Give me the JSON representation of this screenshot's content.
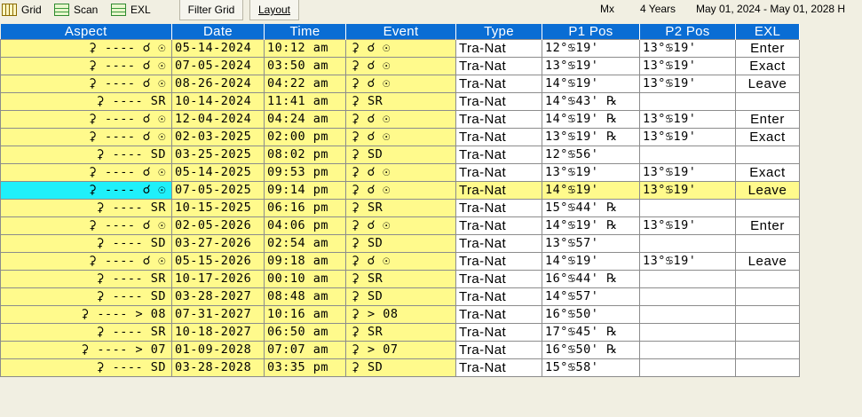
{
  "toolbar": {
    "grid_label": "Grid",
    "scan_label": "Scan",
    "exl_label": "EXL",
    "filter_grid_label": "Filter Grid",
    "layout_label": "Layout",
    "mx_label": "Mx",
    "span_label": "4 Years",
    "range_label": "May 01, 2024 - May 01, 2028 H"
  },
  "table": {
    "headers": {
      "aspect": "Aspect",
      "date": "Date",
      "time": "Time",
      "event": "Event",
      "type": "Type",
      "p1": "P1 Pos",
      "p2": "P2 Pos",
      "exl": "EXL"
    },
    "rows": [
      {
        "aspect": "⚳ ---- ☌ ☉",
        "date": "05-14-2024",
        "time": "10:12 am",
        "event": "⚳ ☌ ☉",
        "type": "Tra-Nat",
        "p1": "12°♋19'",
        "p2": "13°♋19'",
        "exl": "Enter",
        "highlight": false
      },
      {
        "aspect": "⚳ ---- ☌ ☉",
        "date": "07-05-2024",
        "time": "03:50 am",
        "event": "⚳ ☌ ☉",
        "type": "Tra-Nat",
        "p1": "13°♋19'",
        "p2": "13°♋19'",
        "exl": "Exact",
        "highlight": false
      },
      {
        "aspect": "⚳ ---- ☌ ☉",
        "date": "08-26-2024",
        "time": "04:22 am",
        "event": "⚳ ☌ ☉",
        "type": "Tra-Nat",
        "p1": "14°♋19'",
        "p2": "13°♋19'",
        "exl": "Leave",
        "highlight": false
      },
      {
        "aspect": "⚳ ---- SR",
        "date": "10-14-2024",
        "time": "11:41 am",
        "event": "⚳ SR",
        "type": "Tra-Nat",
        "p1": "14°♋43' ℞",
        "p2": "",
        "exl": "",
        "highlight": false
      },
      {
        "aspect": "⚳ ---- ☌ ☉",
        "date": "12-04-2024",
        "time": "04:24 am",
        "event": "⚳ ☌ ☉",
        "type": "Tra-Nat",
        "p1": "14°♋19' ℞",
        "p2": "13°♋19'",
        "exl": "Enter",
        "highlight": false
      },
      {
        "aspect": "⚳ ---- ☌ ☉",
        "date": "02-03-2025",
        "time": "02:00 pm",
        "event": "⚳ ☌ ☉",
        "type": "Tra-Nat",
        "p1": "13°♋19' ℞",
        "p2": "13°♋19'",
        "exl": "Exact",
        "highlight": false
      },
      {
        "aspect": "⚳ ---- SD",
        "date": "03-25-2025",
        "time": "08:02 pm",
        "event": "⚳ SD",
        "type": "Tra-Nat",
        "p1": "12°♋56'",
        "p2": "",
        "exl": "",
        "highlight": false
      },
      {
        "aspect": "⚳ ---- ☌ ☉",
        "date": "05-14-2025",
        "time": "09:53 pm",
        "event": "⚳ ☌ ☉",
        "type": "Tra-Nat",
        "p1": "13°♋19'",
        "p2": "13°♋19'",
        "exl": "Exact",
        "highlight": false
      },
      {
        "aspect": "⚳ ---- ☌ ☉",
        "date": "07-05-2025",
        "time": "09:14 pm",
        "event": "⚳ ☌ ☉",
        "type": "Tra-Nat",
        "p1": "14°♋19'",
        "p2": "13°♋19'",
        "exl": "Leave",
        "highlight": true
      },
      {
        "aspect": "⚳ ---- SR",
        "date": "10-15-2025",
        "time": "06:16 pm",
        "event": "⚳ SR",
        "type": "Tra-Nat",
        "p1": "15°♋44' ℞",
        "p2": "",
        "exl": "",
        "highlight": false
      },
      {
        "aspect": "⚳ ---- ☌ ☉",
        "date": "02-05-2026",
        "time": "04:06 pm",
        "event": "⚳ ☌ ☉",
        "type": "Tra-Nat",
        "p1": "14°♋19' ℞",
        "p2": "13°♋19'",
        "exl": "Enter",
        "highlight": false
      },
      {
        "aspect": "⚳ ---- SD",
        "date": "03-27-2026",
        "time": "02:54 am",
        "event": "⚳ SD",
        "type": "Tra-Nat",
        "p1": "13°♋57'",
        "p2": "",
        "exl": "",
        "highlight": false
      },
      {
        "aspect": "⚳ ---- ☌ ☉",
        "date": "05-15-2026",
        "time": "09:18 am",
        "event": "⚳ ☌ ☉",
        "type": "Tra-Nat",
        "p1": "14°♋19'",
        "p2": "13°♋19'",
        "exl": "Leave",
        "highlight": false
      },
      {
        "aspect": "⚳ ---- SR",
        "date": "10-17-2026",
        "time": "00:10 am",
        "event": "⚳ SR",
        "type": "Tra-Nat",
        "p1": "16°♋44' ℞",
        "p2": "",
        "exl": "",
        "highlight": false
      },
      {
        "aspect": "⚳ ---- SD",
        "date": "03-28-2027",
        "time": "08:48 am",
        "event": "⚳ SD",
        "type": "Tra-Nat",
        "p1": "14°♋57'",
        "p2": "",
        "exl": "",
        "highlight": false
      },
      {
        "aspect": "⚳ ---- > 08",
        "date": "07-31-2027",
        "time": "10:16 am",
        "event": "⚳ > 08",
        "type": "Tra-Nat",
        "p1": "16°♋50'",
        "p2": "",
        "exl": "",
        "highlight": false
      },
      {
        "aspect": "⚳ ---- SR",
        "date": "10-18-2027",
        "time": "06:50 am",
        "event": "⚳ SR",
        "type": "Tra-Nat",
        "p1": "17°♋45' ℞",
        "p2": "",
        "exl": "",
        "highlight": false
      },
      {
        "aspect": "⚳ ---- > 07",
        "date": "01-09-2028",
        "time": "07:07 am",
        "event": "⚳ > 07",
        "type": "Tra-Nat",
        "p1": "16°♋50' ℞",
        "p2": "",
        "exl": "",
        "highlight": false
      },
      {
        "aspect": "⚳ ---- SD",
        "date": "03-28-2028",
        "time": "03:35 pm",
        "event": "⚳ SD",
        "type": "Tra-Nat",
        "p1": "15°♋58'",
        "p2": "",
        "exl": "",
        "highlight": false
      }
    ]
  },
  "colors": {
    "header_bg": "#0a6dd4",
    "cell_yellow": "#fffa8c",
    "cell_highlight": "#1ff0fa",
    "app_bg": "#f1efe2"
  }
}
